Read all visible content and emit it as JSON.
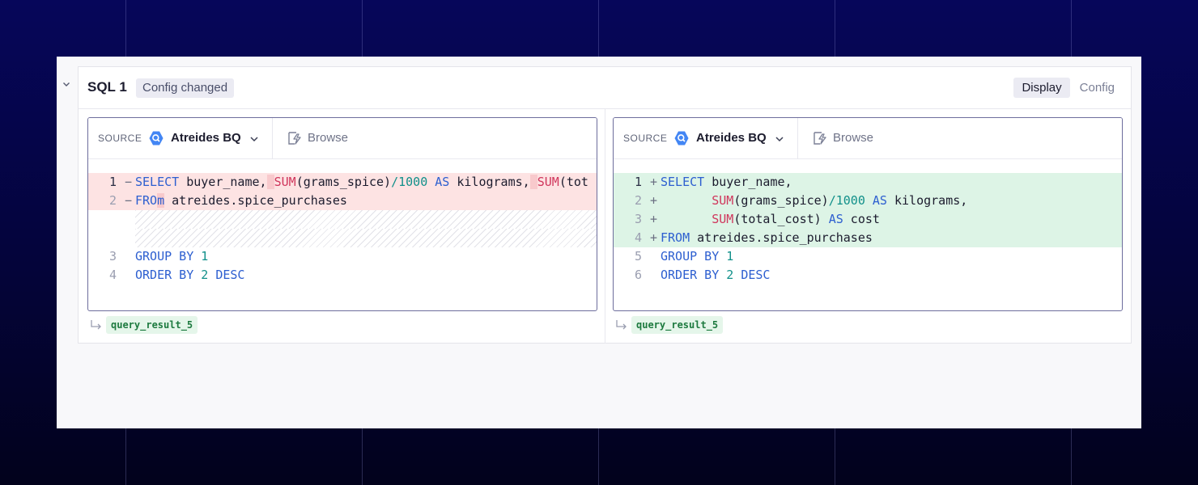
{
  "cell": {
    "title": "SQL 1",
    "badge": "Config changed",
    "tabs": [
      {
        "label": "Display",
        "active": true
      },
      {
        "label": "Config",
        "active": false
      }
    ]
  },
  "left_pane": {
    "source_label": "SOURCE",
    "source_name": "Atreides BQ",
    "browse_label": "Browse",
    "result_name": "query_result_5",
    "lines": [
      {
        "n": "1",
        "mark": "−",
        "kind": "del",
        "text": "SELECT buyer_name, SUM(grams_spice)/1000 AS kilograms, SUM(tot"
      },
      {
        "n": "2",
        "mark": "−",
        "kind": "del",
        "text": "FROm atreides.spice_purchases"
      },
      {
        "n": "",
        "mark": "",
        "kind": "hatch",
        "text": ""
      },
      {
        "n": "",
        "mark": "",
        "kind": "hatch",
        "text": ""
      },
      {
        "n": "3",
        "mark": "",
        "kind": "ctx",
        "text": "GROUP BY 1"
      },
      {
        "n": "4",
        "mark": "",
        "kind": "ctx",
        "text": "ORDER BY 2 DESC"
      }
    ]
  },
  "right_pane": {
    "source_label": "SOURCE",
    "source_name": "Atreides BQ",
    "browse_label": "Browse",
    "result_name": "query_result_5",
    "lines": [
      {
        "n": "1",
        "mark": "+",
        "kind": "add",
        "text": "SELECT buyer_name,"
      },
      {
        "n": "2",
        "mark": "+",
        "kind": "add",
        "text": "       SUM(grams_spice)/1000 AS kilograms,"
      },
      {
        "n": "3",
        "mark": "+",
        "kind": "add",
        "text": "       SUM(total_cost) AS cost"
      },
      {
        "n": "4",
        "mark": "+",
        "kind": "add",
        "text": "FROM atreides.spice_purchases"
      },
      {
        "n": "5",
        "mark": "",
        "kind": "ctx",
        "text": "GROUP BY 1"
      },
      {
        "n": "6",
        "mark": "",
        "kind": "ctx",
        "text": "ORDER BY 2 DESC"
      }
    ]
  },
  "colors": {
    "background": "#04043a",
    "deleted_line": "#fde3e3",
    "added_line": "#ddf4e6",
    "keyword": "#2d5fd0",
    "function": "#d0365c",
    "number": "#11908a",
    "bigquery_blue": "#4386f4"
  },
  "icons": {
    "collapse": "chevron-down-icon",
    "source": "bigquery-icon",
    "browse": "browse-lightning-icon",
    "result": "return-arrow-icon"
  }
}
